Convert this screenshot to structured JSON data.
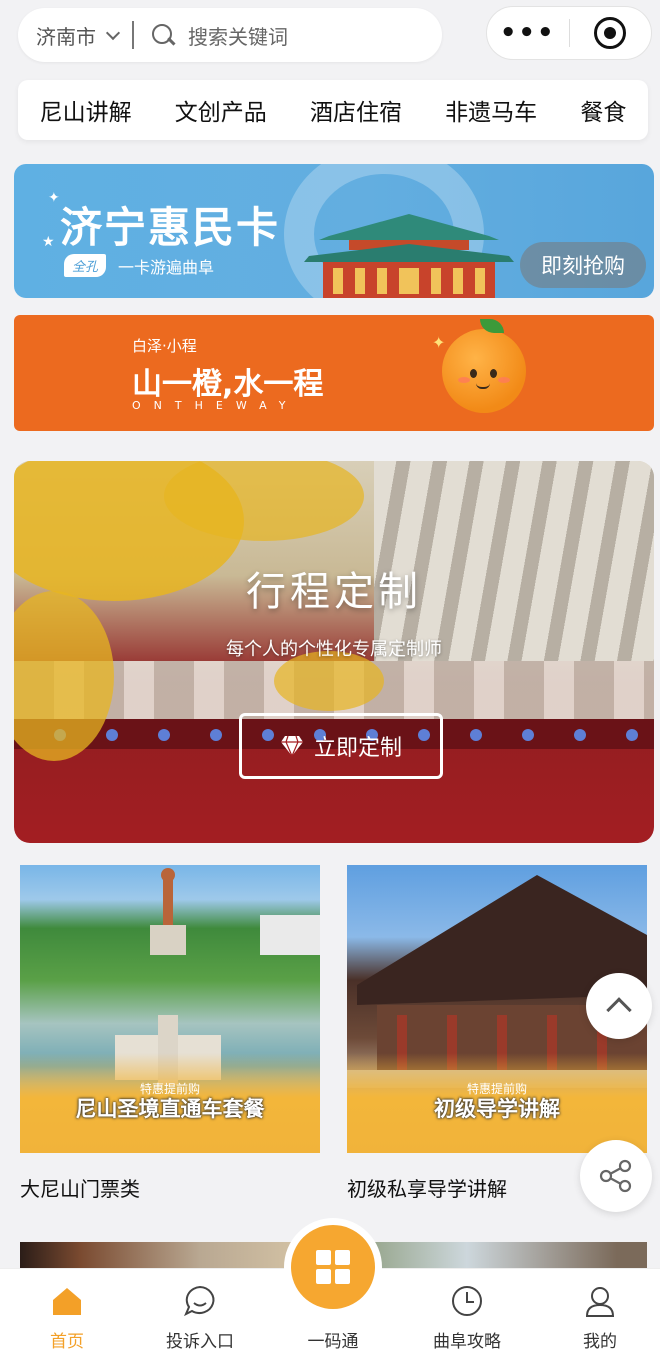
{
  "search": {
    "city": "济南市",
    "placeholder": "搜索关键词"
  },
  "capsule": {
    "more_glyph": "•••"
  },
  "categories": [
    "尼山讲解",
    "文创产品",
    "酒店住宿",
    "非遗马车",
    "餐食"
  ],
  "banner_card": {
    "title": "济宁惠民卡",
    "pill": "全孔",
    "tagline": "一卡游遍曲阜",
    "cta": "即刻抢购",
    "bg": "#5fb0e3"
  },
  "banner_orange": {
    "small": "白泽·小程",
    "main": "山一橙,水一程",
    "english": "ONTHEWAY",
    "bg": "#ec6a1f"
  },
  "trip": {
    "title": "行程定制",
    "subtitle": "每个人的个性化专属定制师",
    "button": "立即定制",
    "button_icon": "diamond-icon"
  },
  "products": [
    {
      "tag": "特惠提前购",
      "caption": "尼山圣境直通车套餐",
      "name": "大尼山门票类"
    },
    {
      "tag": "特惠提前购",
      "caption": "初级导学讲解",
      "name": "初级私享导学讲解"
    }
  ],
  "floating": {
    "scroll_top_icon": "chevron-up-icon",
    "share_icon": "share-icon"
  },
  "tabbar": {
    "active_color": "#f3a028",
    "items": [
      {
        "label": "首页",
        "icon": "home-icon"
      },
      {
        "label": "投诉入口",
        "icon": "chat-icon"
      },
      {
        "label": "一码通",
        "icon": "grid-icon"
      },
      {
        "label": "曲阜攻略",
        "icon": "clock-icon"
      },
      {
        "label": "我的",
        "icon": "user-icon"
      }
    ]
  }
}
